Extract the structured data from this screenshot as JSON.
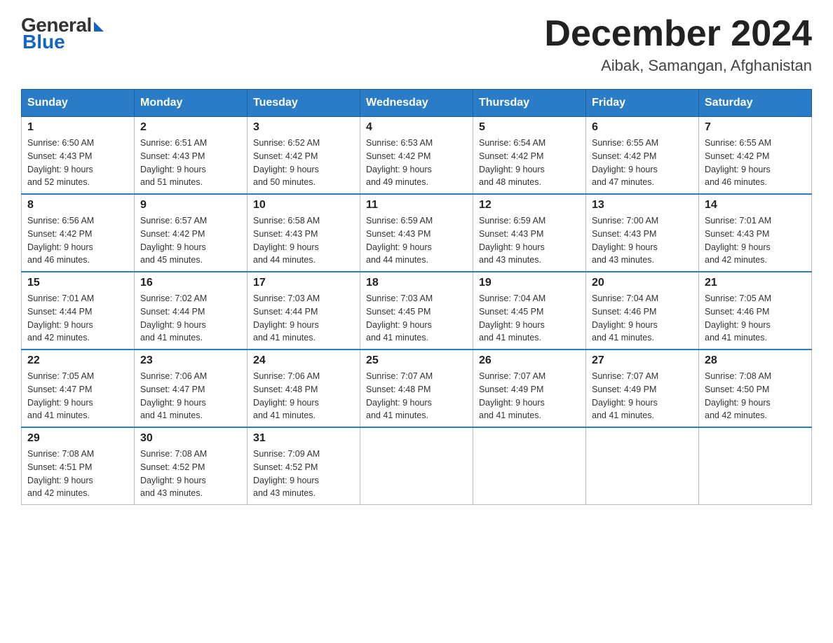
{
  "header": {
    "logo": {
      "general": "General",
      "blue": "Blue"
    },
    "month_title": "December 2024",
    "location": "Aibak, Samangan, Afghanistan"
  },
  "days_of_week": [
    "Sunday",
    "Monday",
    "Tuesday",
    "Wednesday",
    "Thursday",
    "Friday",
    "Saturday"
  ],
  "weeks": [
    [
      {
        "day": "1",
        "sunrise": "6:50 AM",
        "sunset": "4:43 PM",
        "daylight": "9 hours and 52 minutes."
      },
      {
        "day": "2",
        "sunrise": "6:51 AM",
        "sunset": "4:43 PM",
        "daylight": "9 hours and 51 minutes."
      },
      {
        "day": "3",
        "sunrise": "6:52 AM",
        "sunset": "4:42 PM",
        "daylight": "9 hours and 50 minutes."
      },
      {
        "day": "4",
        "sunrise": "6:53 AM",
        "sunset": "4:42 PM",
        "daylight": "9 hours and 49 minutes."
      },
      {
        "day": "5",
        "sunrise": "6:54 AM",
        "sunset": "4:42 PM",
        "daylight": "9 hours and 48 minutes."
      },
      {
        "day": "6",
        "sunrise": "6:55 AM",
        "sunset": "4:42 PM",
        "daylight": "9 hours and 47 minutes."
      },
      {
        "day": "7",
        "sunrise": "6:55 AM",
        "sunset": "4:42 PM",
        "daylight": "9 hours and 46 minutes."
      }
    ],
    [
      {
        "day": "8",
        "sunrise": "6:56 AM",
        "sunset": "4:42 PM",
        "daylight": "9 hours and 46 minutes."
      },
      {
        "day": "9",
        "sunrise": "6:57 AM",
        "sunset": "4:42 PM",
        "daylight": "9 hours and 45 minutes."
      },
      {
        "day": "10",
        "sunrise": "6:58 AM",
        "sunset": "4:43 PM",
        "daylight": "9 hours and 44 minutes."
      },
      {
        "day": "11",
        "sunrise": "6:59 AM",
        "sunset": "4:43 PM",
        "daylight": "9 hours and 44 minutes."
      },
      {
        "day": "12",
        "sunrise": "6:59 AM",
        "sunset": "4:43 PM",
        "daylight": "9 hours and 43 minutes."
      },
      {
        "day": "13",
        "sunrise": "7:00 AM",
        "sunset": "4:43 PM",
        "daylight": "9 hours and 43 minutes."
      },
      {
        "day": "14",
        "sunrise": "7:01 AM",
        "sunset": "4:43 PM",
        "daylight": "9 hours and 42 minutes."
      }
    ],
    [
      {
        "day": "15",
        "sunrise": "7:01 AM",
        "sunset": "4:44 PM",
        "daylight": "9 hours and 42 minutes."
      },
      {
        "day": "16",
        "sunrise": "7:02 AM",
        "sunset": "4:44 PM",
        "daylight": "9 hours and 41 minutes."
      },
      {
        "day": "17",
        "sunrise": "7:03 AM",
        "sunset": "4:44 PM",
        "daylight": "9 hours and 41 minutes."
      },
      {
        "day": "18",
        "sunrise": "7:03 AM",
        "sunset": "4:45 PM",
        "daylight": "9 hours and 41 minutes."
      },
      {
        "day": "19",
        "sunrise": "7:04 AM",
        "sunset": "4:45 PM",
        "daylight": "9 hours and 41 minutes."
      },
      {
        "day": "20",
        "sunrise": "7:04 AM",
        "sunset": "4:46 PM",
        "daylight": "9 hours and 41 minutes."
      },
      {
        "day": "21",
        "sunrise": "7:05 AM",
        "sunset": "4:46 PM",
        "daylight": "9 hours and 41 minutes."
      }
    ],
    [
      {
        "day": "22",
        "sunrise": "7:05 AM",
        "sunset": "4:47 PM",
        "daylight": "9 hours and 41 minutes."
      },
      {
        "day": "23",
        "sunrise": "7:06 AM",
        "sunset": "4:47 PM",
        "daylight": "9 hours and 41 minutes."
      },
      {
        "day": "24",
        "sunrise": "7:06 AM",
        "sunset": "4:48 PM",
        "daylight": "9 hours and 41 minutes."
      },
      {
        "day": "25",
        "sunrise": "7:07 AM",
        "sunset": "4:48 PM",
        "daylight": "9 hours and 41 minutes."
      },
      {
        "day": "26",
        "sunrise": "7:07 AM",
        "sunset": "4:49 PM",
        "daylight": "9 hours and 41 minutes."
      },
      {
        "day": "27",
        "sunrise": "7:07 AM",
        "sunset": "4:49 PM",
        "daylight": "9 hours and 41 minutes."
      },
      {
        "day": "28",
        "sunrise": "7:08 AM",
        "sunset": "4:50 PM",
        "daylight": "9 hours and 42 minutes."
      }
    ],
    [
      {
        "day": "29",
        "sunrise": "7:08 AM",
        "sunset": "4:51 PM",
        "daylight": "9 hours and 42 minutes."
      },
      {
        "day": "30",
        "sunrise": "7:08 AM",
        "sunset": "4:52 PM",
        "daylight": "9 hours and 43 minutes."
      },
      {
        "day": "31",
        "sunrise": "7:09 AM",
        "sunset": "4:52 PM",
        "daylight": "9 hours and 43 minutes."
      },
      null,
      null,
      null,
      null
    ]
  ]
}
